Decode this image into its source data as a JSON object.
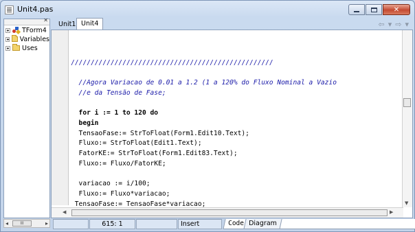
{
  "window": {
    "title": "Unit4.pas"
  },
  "explorer": {
    "items": [
      {
        "label": "TForm4",
        "icon": "component-icon"
      },
      {
        "label": "Variables",
        "icon": "folder-icon"
      },
      {
        "label": "Uses",
        "icon": "folder-icon"
      }
    ],
    "scroll_thumb": "III"
  },
  "tabs": [
    {
      "label": "Unit1"
    },
    {
      "label": "Unit4"
    }
  ],
  "code_lines": [
    "///////////////////////////////////////////////////",
    "",
    "  //Agora Variacao de 0.01 a 1.2 (1 a 120% do Fluxo Nominal a Vazio",
    "  //e da Tensão de Fase;",
    "",
    "  for i := 1 to 120 do",
    "  begin",
    "  TensaoFase:= StrToFloat(Form1.Edit10.Text);",
    "  Fluxo:= StrToFloat(Edit1.Text);",
    "  FatorKE:= StrToFloat(Form1.Edit83.Text);",
    "  Fluxo:= Fluxo/FatorKE;",
    "",
    "  variacao := i/100;",
    "  Fluxo:= Fluxo*variacao;",
    " TensaoFase:= TensaoFase*variacao;"
  ],
  "status": {
    "position": "615:  1",
    "modified": "",
    "insert_mode": "Insert",
    "view_tabs": [
      "Code",
      "Diagram"
    ]
  }
}
